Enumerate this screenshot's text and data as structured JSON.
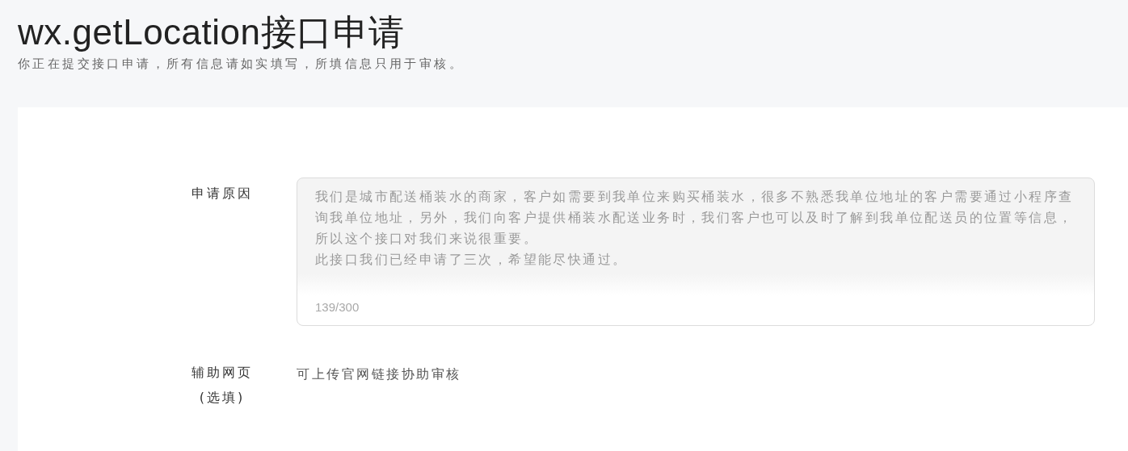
{
  "header": {
    "title": "wx.getLocation接口申请",
    "subtitle": "你正在提交接口申请，所有信息请如实填写，所填信息只用于审核。"
  },
  "form": {
    "fields": [
      {
        "kind": "textarea",
        "label": "申请原因",
        "paragraphs": [
          "我们是城市配送桶装水的商家，客户如需要到我单位来购买桶装水，很多不熟悉我单位地址的客户需要通过小程序查询我单位地址，另外，我们向客户提供桶装水配送业务时，我们客户也可以及时了解到我单位配送员的位置等信息，所以这个接口对我们来说很重要。",
          "此接口我们已经申请了三次，希望能尽快通过。"
        ],
        "counter": "139/300"
      },
      {
        "kind": "hint",
        "label": "辅助网页\n(选填)",
        "hint": "可上传官网链接协助审核"
      }
    ]
  }
}
